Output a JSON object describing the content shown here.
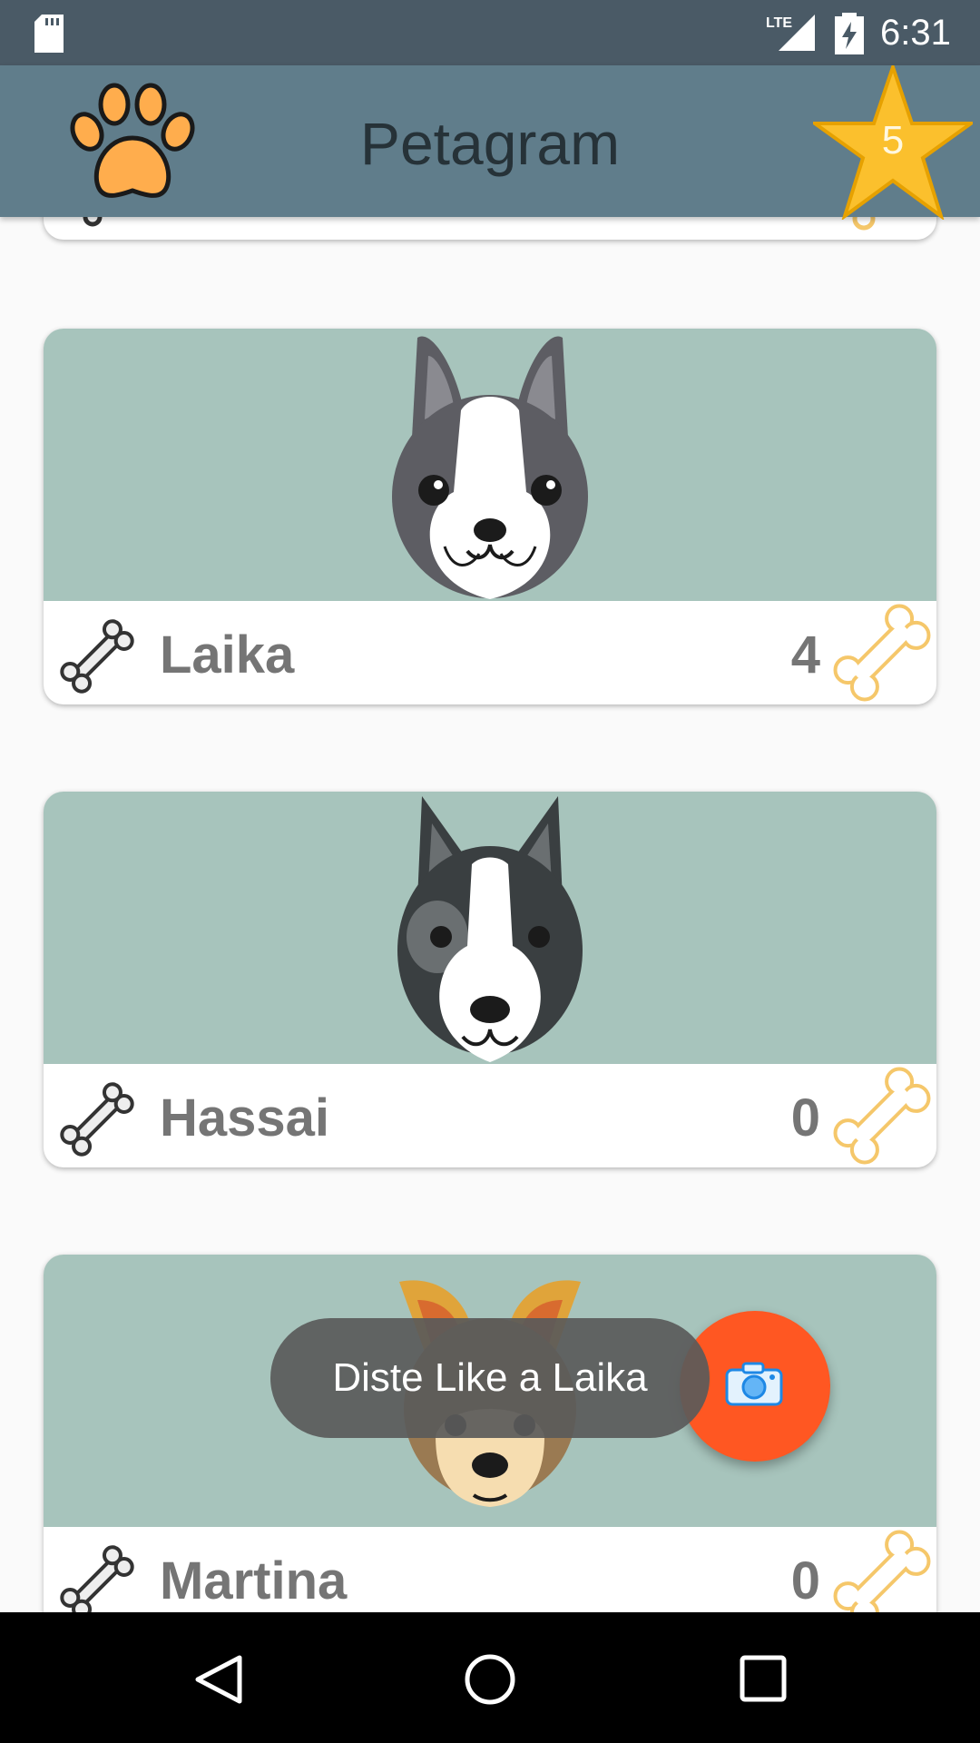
{
  "status_bar": {
    "network": "LTE",
    "time": "6:31"
  },
  "app_bar": {
    "title": "Petagram",
    "favorites_count": "5",
    "logo_icon": "paw-icon",
    "favorites_icon": "star-icon"
  },
  "pets": [
    {
      "name": "Laika",
      "likes": "4"
    },
    {
      "name": "Hassai",
      "likes": "0"
    },
    {
      "name": "Martina",
      "likes": "0"
    }
  ],
  "toast": {
    "message": "Diste Like a Laika"
  },
  "fab": {
    "icon": "camera-icon"
  },
  "nav": {
    "back": "back-icon",
    "home": "home-icon",
    "recents": "recents-icon"
  },
  "colors": {
    "app_bar": "#607d8b",
    "status_bar": "#4a5a66",
    "photo_bg": "#a7c4bc",
    "fab": "#ff5722",
    "bone_like": "#f5c76a"
  }
}
